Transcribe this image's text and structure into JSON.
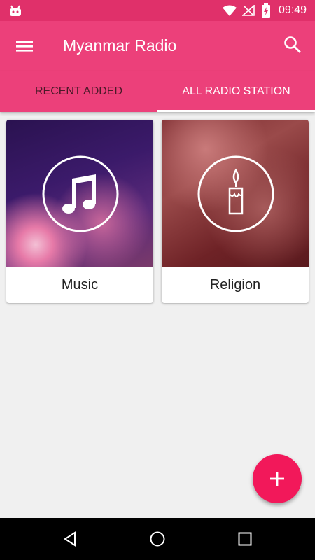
{
  "status_bar": {
    "time": "09:49",
    "icons": [
      "android-icon",
      "wifi-icon",
      "no-signal-icon",
      "battery-charging-icon"
    ]
  },
  "app_bar": {
    "title": "Myanmar Radio",
    "menu_icon": "menu-icon",
    "search_icon": "search-icon"
  },
  "tabs": [
    {
      "label": "RECENT ADDED",
      "selected": false
    },
    {
      "label": "ALL RADIO STATION",
      "selected": true
    }
  ],
  "categories": [
    {
      "label": "Music",
      "icon": "music-note-icon"
    },
    {
      "label": "Religion",
      "icon": "candle-icon"
    }
  ],
  "fab": {
    "icon": "plus-icon"
  },
  "nav_bar": {
    "icons": [
      "back-icon",
      "home-icon",
      "recent-apps-icon"
    ]
  },
  "colors": {
    "status_bar": "#e0306a",
    "app_bar": "#ec407a",
    "fab": "#f2185a",
    "background": "#f0f0f0"
  }
}
